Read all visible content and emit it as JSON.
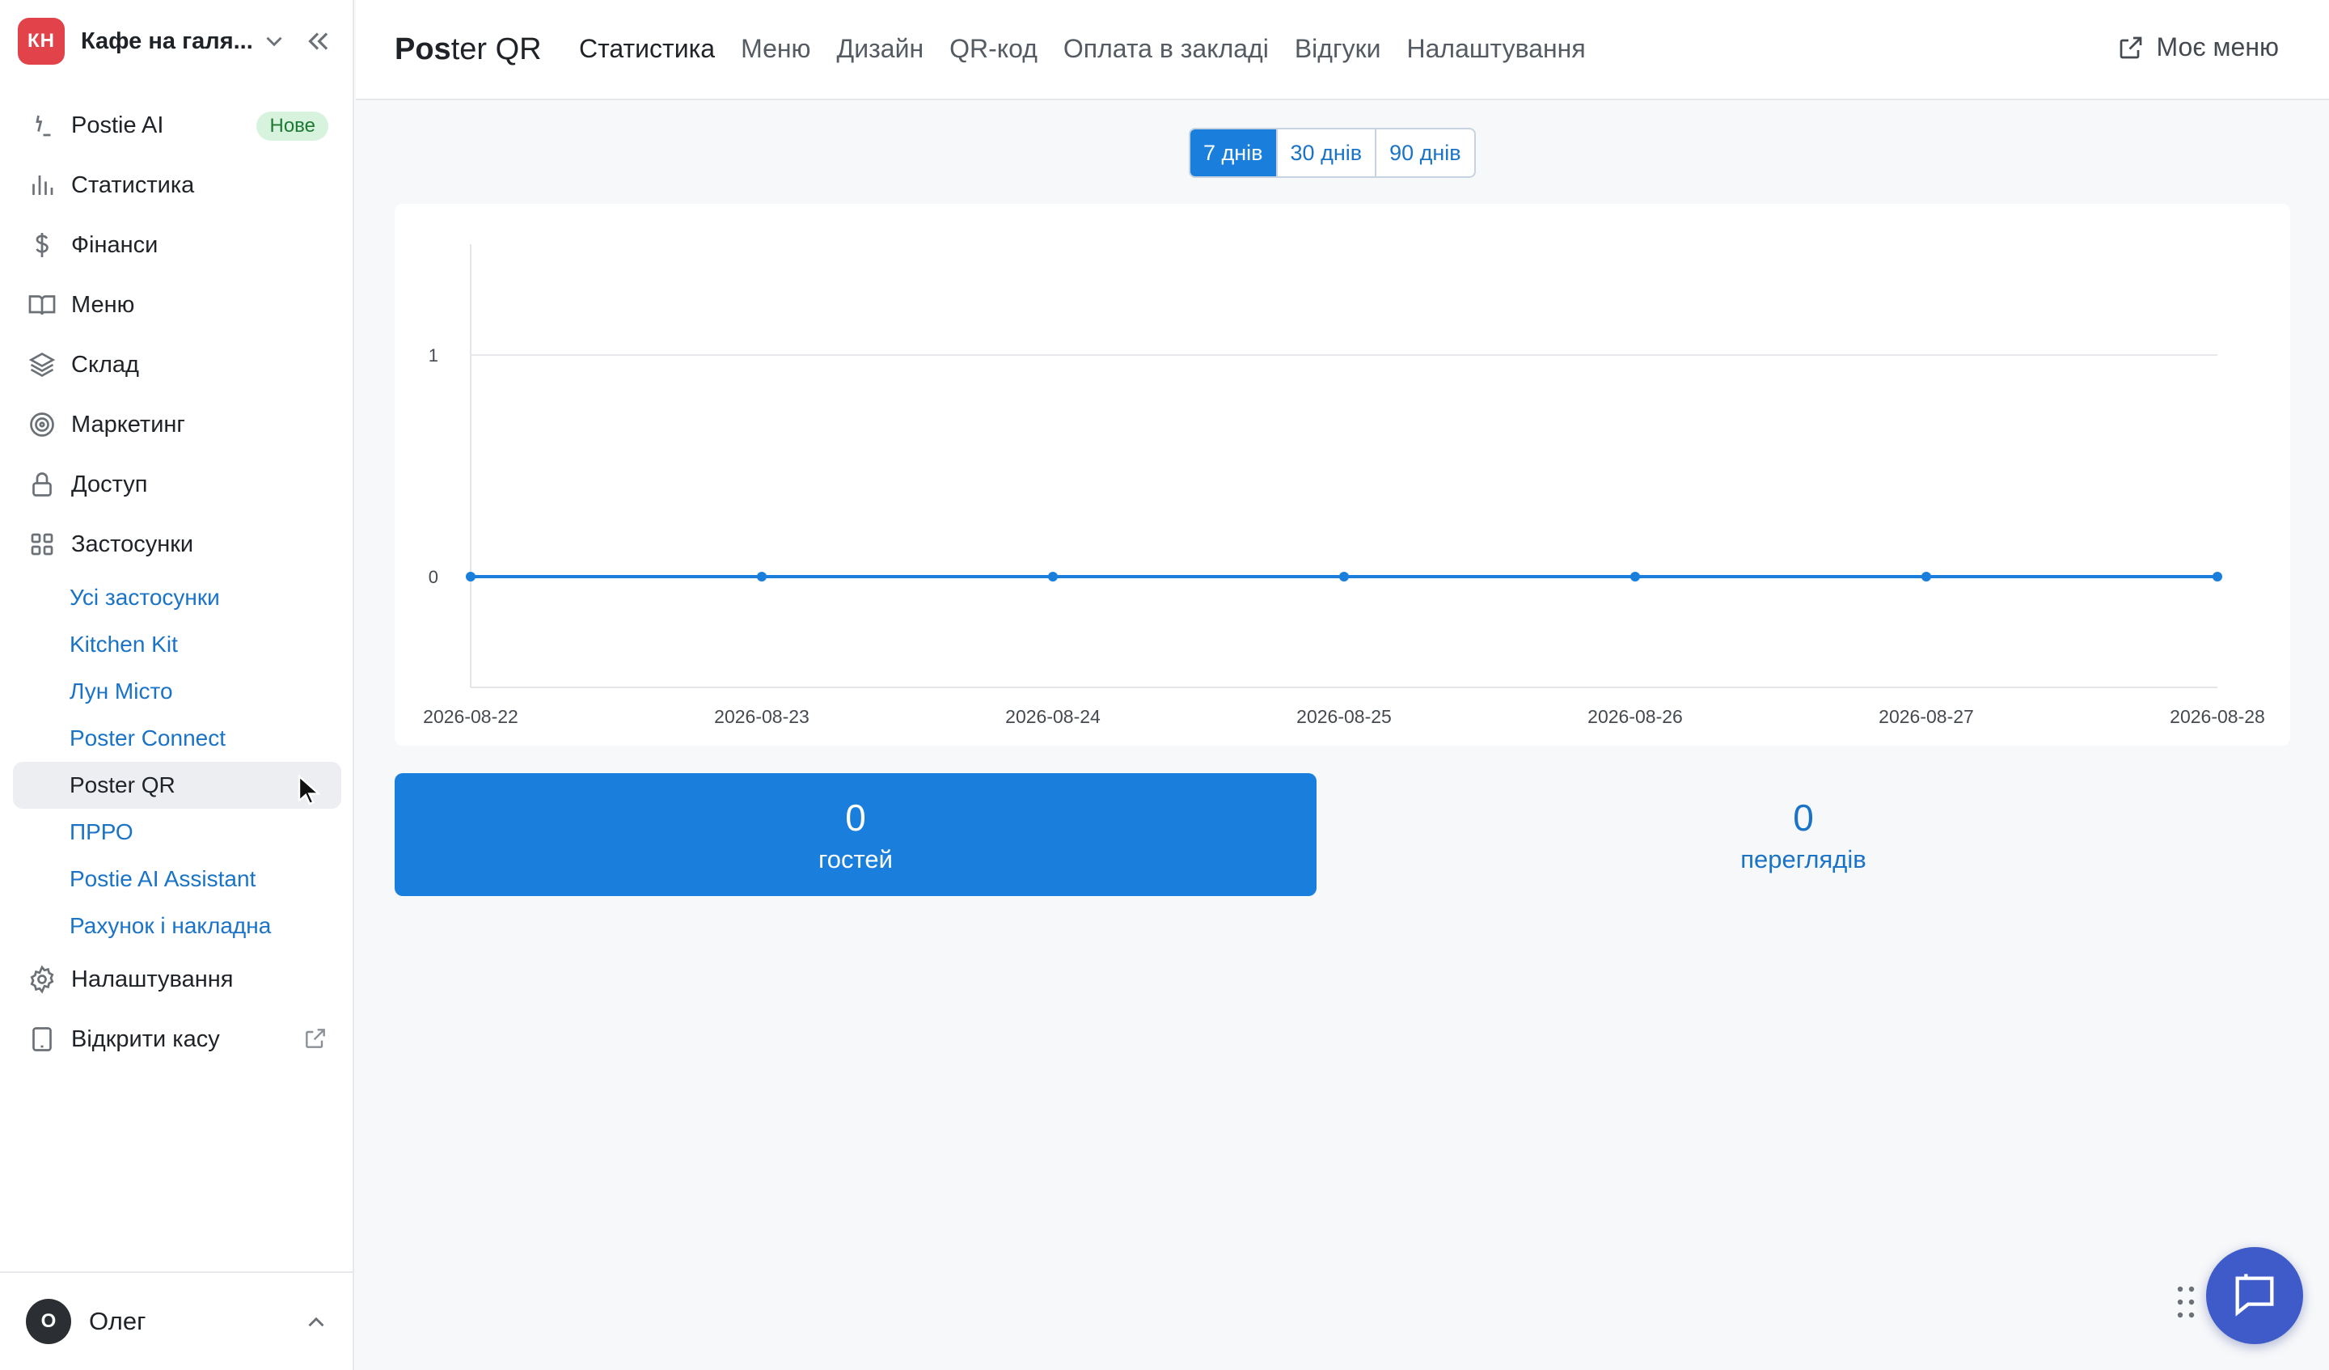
{
  "sidebar": {
    "venue": {
      "initials": "КН",
      "name": "Кафе на галя..."
    },
    "items": [
      {
        "label": "Postie AI",
        "icon": "postie-ai-icon",
        "badge": "Нове"
      },
      {
        "label": "Статистика",
        "icon": "bar-chart-icon"
      },
      {
        "label": "Фінанси",
        "icon": "dollar-icon"
      },
      {
        "label": "Меню",
        "icon": "book-icon"
      },
      {
        "label": "Склад",
        "icon": "layers-icon"
      },
      {
        "label": "Маркетинг",
        "icon": "target-icon"
      },
      {
        "label": "Доступ",
        "icon": "lock-icon"
      },
      {
        "label": "Застосунки",
        "icon": "grid-icon"
      }
    ],
    "apps": [
      {
        "label": "Усі застосунки"
      },
      {
        "label": "Kitchen Kit"
      },
      {
        "label": "Лун Місто"
      },
      {
        "label": "Poster Connect"
      },
      {
        "label": "Poster QR",
        "active": true
      },
      {
        "label": "ПРРО"
      },
      {
        "label": "Postie AI Assistant"
      },
      {
        "label": "Рахунок і накладна"
      }
    ],
    "bottom_items": [
      {
        "label": "Налаштування",
        "icon": "gear-icon"
      },
      {
        "label": "Відкрити касу",
        "icon": "tablet-icon"
      }
    ],
    "user": {
      "initial": "О",
      "name": "Олег"
    }
  },
  "header": {
    "title_bold": "Pos",
    "title_rest": "ter QR",
    "tabs": [
      {
        "label": "Статистика",
        "active": true
      },
      {
        "label": "Меню"
      },
      {
        "label": "Дизайн"
      },
      {
        "label": "QR-код"
      },
      {
        "label": "Оплата в закладі"
      },
      {
        "label": "Відгуки"
      },
      {
        "label": "Налаштування"
      }
    ],
    "my_menu": "Моє меню"
  },
  "period": {
    "options": [
      "7 днів",
      "30 днів",
      "90 днів"
    ],
    "selected": 0
  },
  "chart_data": {
    "type": "line",
    "x": [
      "2026-08-22",
      "2026-08-23",
      "2026-08-24",
      "2026-08-25",
      "2026-08-26",
      "2026-08-27",
      "2026-08-28"
    ],
    "series": [
      {
        "values": [
          0,
          0,
          0,
          0,
          0,
          0,
          0
        ]
      }
    ],
    "yticks": [
      0,
      1
    ],
    "ylim": [
      -0.5,
      1.5
    ],
    "grid": true,
    "color": "#1a7fdc"
  },
  "stats": {
    "guests": {
      "value": "0",
      "label": "гостей"
    },
    "views": {
      "value": "0",
      "label": "переглядів"
    }
  },
  "colors": {
    "accent": "#1a7fdc",
    "link": "#1a73c7",
    "venue_badge": "#e2434b",
    "chat": "#3f5bc9"
  }
}
